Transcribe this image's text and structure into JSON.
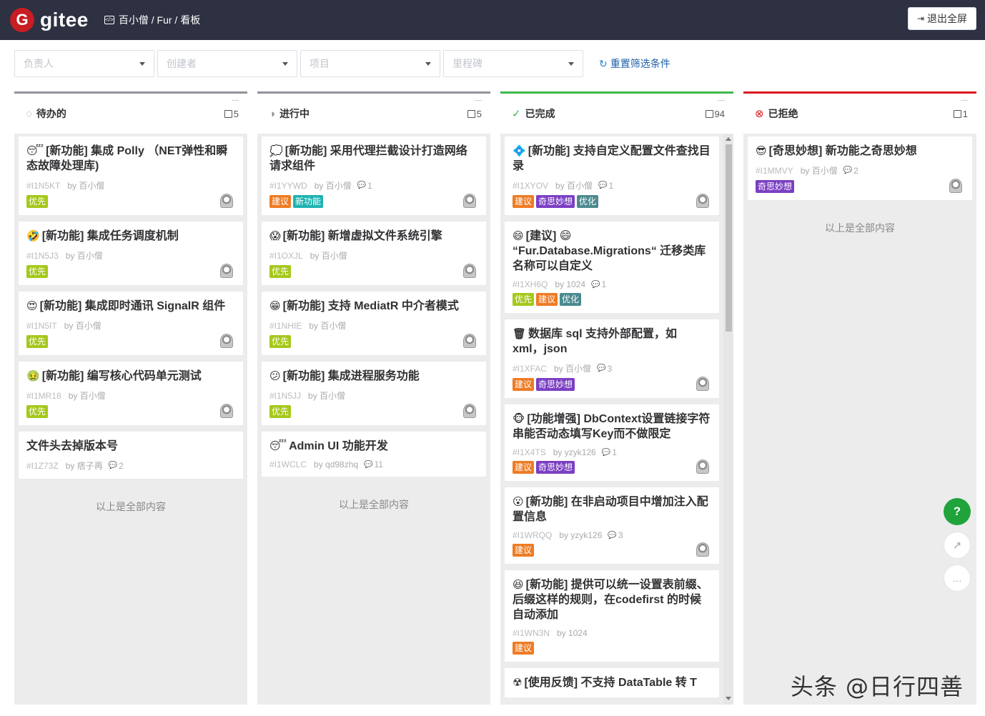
{
  "header": {
    "logo_mark": "G",
    "logo_text": "gitee",
    "breadcrumb": "百小僧 / Fur / 看板",
    "exit_button": "退出全屏"
  },
  "filters": {
    "assignee": "负责人",
    "creator": "创建者",
    "project": "项目",
    "milestone": "里程碑",
    "reset": "重置筛选条件"
  },
  "colors": {
    "todo": "#909399",
    "doing": "#909399",
    "done": "#3cb84a",
    "rejected": "#d9191e",
    "tag_priority": "#a5c81c",
    "tag_suggest": "#ef7b23",
    "tag_feature": "#1eb3b0",
    "tag_idea": "#7b3fc3",
    "tag_optimize": "#4b8a8f"
  },
  "columns": [
    {
      "title": "待办的",
      "count": "5",
      "icon": "circle-dashed-icon",
      "end_note": "以上是全部内容",
      "cards": [
        {
          "emoji": "😴",
          "title": "[新功能] 集成 Polly （NET弹性和瞬态故障处理库)",
          "id": "#I1N5KT",
          "by": "by 百小僧",
          "comments": "",
          "tags": [
            "优先"
          ],
          "avatar": true
        },
        {
          "emoji": "🤣",
          "title": "[新功能] 集成任务调度机制",
          "id": "#I1N5J3",
          "by": "by 百小僧",
          "comments": "",
          "tags": [
            "优先"
          ],
          "avatar": true
        },
        {
          "emoji": "😍",
          "title": "[新功能] 集成即时通讯 SignalR 组件",
          "id": "#I1N5IT",
          "by": "by 百小僧",
          "comments": "",
          "tags": [
            "优先"
          ],
          "avatar": true
        },
        {
          "emoji": "🤢",
          "title": "[新功能] 编写核心代码单元测试",
          "id": "#I1MR18",
          "by": "by 百小僧",
          "comments": "",
          "tags": [
            "优先"
          ],
          "avatar": true
        },
        {
          "emoji": "",
          "title": "文件头去掉版本号",
          "id": "#I1Z73Z",
          "by": "by 痞子再",
          "comments": "2",
          "tags": [],
          "avatar": false
        }
      ]
    },
    {
      "title": "进行中",
      "count": "5",
      "icon": "half-circle-icon",
      "end_note": "以上是全部内容",
      "cards": [
        {
          "emoji": "💭",
          "title": "[新功能] 采用代理拦截设计打造网络请求组件",
          "id": "#I1YYWD",
          "by": "by 百小僧",
          "comments": "1",
          "tags": [
            "建议",
            "新功能"
          ],
          "avatar": true
        },
        {
          "emoji": "😱",
          "title": "[新功能] 新增虚拟文件系统引擎",
          "id": "#I1OXJL",
          "by": "by 百小僧",
          "comments": "",
          "tags": [
            "优先"
          ],
          "avatar": true
        },
        {
          "emoji": "😁",
          "title": "[新功能] 支持 MediatR 中介者模式",
          "id": "#I1NHIE",
          "by": "by 百小僧",
          "comments": "",
          "tags": [
            "优先"
          ],
          "avatar": true
        },
        {
          "emoji": "😕",
          "title": "[新功能] 集成进程服务功能",
          "id": "#I1N5JJ",
          "by": "by 百小僧",
          "comments": "",
          "tags": [
            "优先"
          ],
          "avatar": true
        },
        {
          "emoji": "😴",
          "title": "Admin UI 功能开发",
          "id": "#I1WCLC",
          "by": "by qd98zhq",
          "comments": "11",
          "tags": [],
          "avatar": false
        }
      ]
    },
    {
      "title": "已完成",
      "count": "94",
      "icon": "check-circle-icon",
      "end_note": "",
      "cards": [
        {
          "emoji": "💠",
          "title": "[新功能] 支持自定义配置文件查找目录",
          "id": "#I1XYOV",
          "by": "by 百小僧",
          "comments": "1",
          "tags": [
            "建议",
            "奇思妙想",
            "优化"
          ],
          "avatar": true
        },
        {
          "emoji": "😄",
          "title": "[建议] 😄 “Fur.Database.Migrations“ 迁移类库名称可以自定义",
          "id": "#I1XH6Q",
          "by": "by 1024",
          "comments": "1",
          "tags": [
            "优先",
            "建议",
            "优化"
          ],
          "avatar": false
        },
        {
          "emoji": "🗑",
          "title": "数据库 sql 支持外部配置，如 xml，json",
          "id": "#I1XFAC",
          "by": "by 百小僧",
          "comments": "3",
          "tags": [
            "建议",
            "奇思妙想"
          ],
          "avatar": true
        },
        {
          "emoji": "🐵",
          "title": "[功能增强] DbContext设置链接字符串能否动态填写Key而不做限定",
          "id": "#I1X4TS",
          "by": "by yzyk126",
          "comments": "1",
          "tags": [
            "建议",
            "奇思妙想"
          ],
          "avatar": true
        },
        {
          "emoji": "😮",
          "title": "[新功能] 在非启动项目中增加注入配置信息",
          "id": "#I1WRQQ",
          "by": "by yzyk126",
          "comments": "3",
          "tags": [
            "建议"
          ],
          "avatar": true
        },
        {
          "emoji": "😆",
          "title": "[新功能] 提供可以统一设置表前缀、后缀这样的规则，在codefirst 的时候自动添加",
          "id": "#I1WN3N",
          "by": "by 1024",
          "comments": "",
          "tags": [
            "建议"
          ],
          "avatar": false
        },
        {
          "emoji": "☢",
          "title": "[使用反馈] 不支持 DataTable 转 T",
          "id": "",
          "by": "",
          "comments": "",
          "tags": [],
          "avatar": false
        }
      ]
    },
    {
      "title": "已拒绝",
      "count": "1",
      "icon": "x-circle-icon",
      "end_note": "以上是全部内容",
      "cards": [
        {
          "emoji": "😎",
          "title": "[奇思妙想] 新功能之奇思妙想",
          "id": "#I1MMVY",
          "by": "by 百小僧",
          "comments": "2",
          "tags": [
            "奇思妙想"
          ],
          "avatar": true
        }
      ]
    }
  ],
  "floating": {
    "help": "?",
    "share": "↗",
    "chat": "…"
  },
  "watermark": "头条 @日行四善"
}
